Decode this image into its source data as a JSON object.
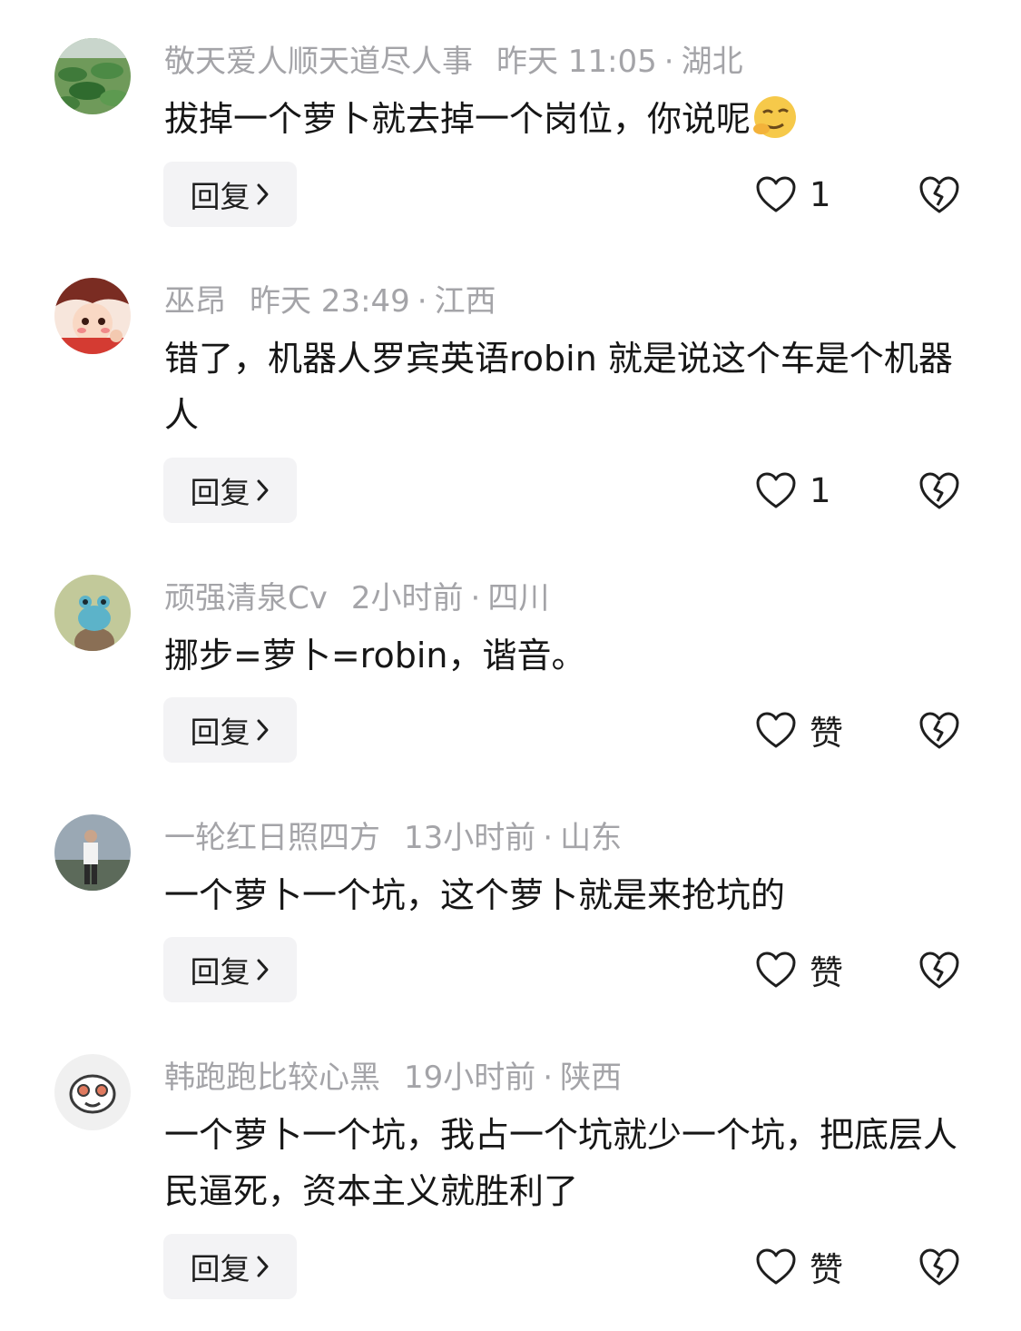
{
  "comments": [
    {
      "username": "敬天爱人顺天道尽人事",
      "time": "昨天 11:05",
      "location": "湖北",
      "text": "拔掉一个萝卜就去掉一个岗位，你说呢",
      "emoji": "smirk-emoji",
      "reply_label": "回复",
      "like_label": "1",
      "avatar": "lotus-pond-avatar"
    },
    {
      "username": "巫昂",
      "time": "昨天 23:49",
      "location": "江西",
      "text": "错了，机器人罗宾英语robin 就是说这个车是个机器人",
      "reply_label": "回复",
      "like_label": "1",
      "avatar": "anime-character-avatar"
    },
    {
      "username": "顽强清泉Cv",
      "time": "2小时前",
      "location": "四川",
      "text": "挪步=萝卜=robin，谐音。",
      "reply_label": "回复",
      "like_label": "赞",
      "avatar": "cartoon-frog-avatar"
    },
    {
      "username": "一轮红日照四方",
      "time": "13小时前",
      "location": "山东",
      "text": "一个萝卜一个坑，这个萝卜就是来抢坑的",
      "reply_label": "回复",
      "like_label": "赞",
      "avatar": "person-photo-avatar"
    },
    {
      "username": "韩跑跑比较心黑",
      "time": "19小时前",
      "location": "陕西",
      "text": "一个萝卜一个坑，我占一个坑就少一个坑，把底层人民逼死，资本主义就胜利了",
      "reply_label": "回复",
      "like_label": "赞",
      "avatar": "cartoon-face-avatar"
    }
  ],
  "separator_dot": "·"
}
